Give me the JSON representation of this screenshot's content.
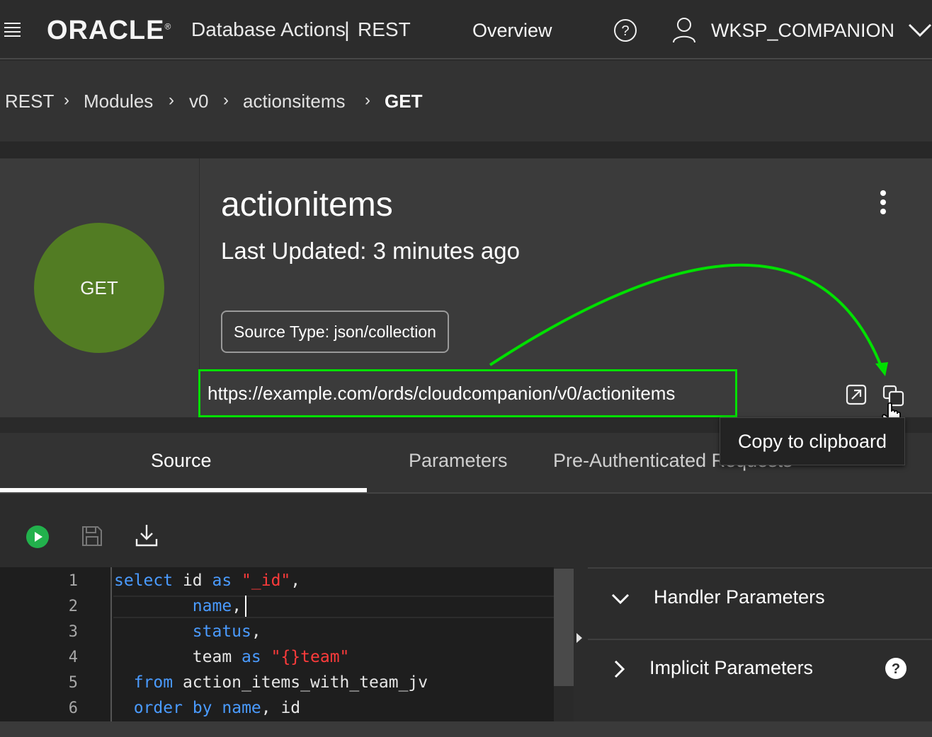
{
  "header": {
    "logo": "ORACLE",
    "logo_mark": "®",
    "app_title": "Database Actions",
    "separator": "|",
    "section": "REST",
    "nav_overview": "Overview",
    "username": "WKSP_COMPANION"
  },
  "breadcrumb": {
    "items": [
      "REST",
      "Modules",
      "v0",
      "actionsitems",
      "GET"
    ],
    "separator": "›"
  },
  "handler": {
    "method": "GET",
    "title": "actionitems",
    "last_updated": "Last Updated: 3 minutes ago",
    "source_type": "Source Type: json/collection",
    "url": "https://example.com/ords/cloudcompanion/v0/actionitems"
  },
  "tooltip": {
    "copy": "Copy to clipboard"
  },
  "tabs": {
    "source": "Source",
    "parameters": "Parameters",
    "pre_authenticated": "Pre-Authenticated Requests"
  },
  "editor": {
    "line_numbers": [
      "1",
      "2",
      "3",
      "4",
      "5",
      "6"
    ],
    "lines": [
      {
        "kw1": "select",
        "t1": " id ",
        "kw2": "as",
        "t2": " ",
        "str": "\"_id\"",
        "t3": ", "
      },
      {
        "dots": "      ",
        "kw1": "name",
        "t1": ","
      },
      {
        "dots": "      ",
        "kw1": "status",
        "t1": ","
      },
      {
        "dots": "      ",
        "t1": "team ",
        "kw1": "as",
        "t2": " ",
        "str": "\"{}team\""
      },
      {
        "dots": "  ",
        "kw1": "from",
        "t1": " action_items_with_team_jv"
      },
      {
        "dots": "  ",
        "kw1": "order",
        "t1": " ",
        "kw2": "by",
        "t2": " ",
        "kw3": "name",
        "t3": ", id"
      }
    ]
  },
  "params": {
    "handler": "Handler Parameters",
    "implicit": "Implicit Parameters"
  },
  "colors": {
    "get_badge": "#527c23",
    "highlight": "#00e000",
    "keyword": "#4a9bff",
    "string": "#ff3b3b",
    "run_button": "#22b14c"
  },
  "icons": {
    "menu": "hamburger-icon",
    "help": "help-circle-icon",
    "user": "user-icon",
    "dropdown": "chevron-down-icon",
    "more": "kebab-icon",
    "open": "open-in-new-icon",
    "copy": "copy-icon",
    "run": "play-icon",
    "save": "save-icon",
    "download": "download-icon"
  }
}
